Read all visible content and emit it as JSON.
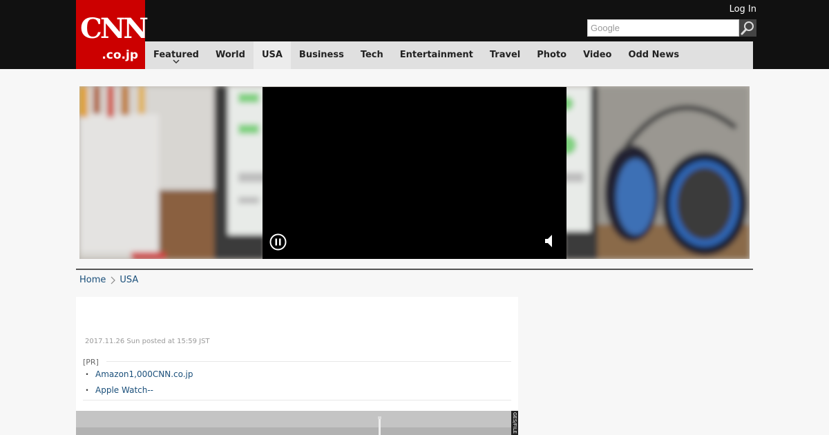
{
  "header": {
    "logo_main": "CNN",
    "logo_sub": ".co.jp",
    "login_label": "Log In",
    "search_placeholder": "Google"
  },
  "nav": {
    "items": [
      {
        "label": "Featured"
      },
      {
        "label": "World"
      },
      {
        "label": "USA"
      },
      {
        "label": "Business"
      },
      {
        "label": "Tech"
      },
      {
        "label": "Entertainment"
      },
      {
        "label": "Travel"
      },
      {
        "label": "Photo"
      },
      {
        "label": "Video"
      },
      {
        "label": "Odd News"
      }
    ],
    "active": "USA"
  },
  "breadcrumb": {
    "home": "Home",
    "current": "USA"
  },
  "article": {
    "dateline": "2017.11.26 Sun posted at 15:59 JST",
    "pr_label": "[PR]",
    "pr_links": [
      {
        "text": "Amazon1,000CNN.co.jp"
      },
      {
        "text": "Apple Watch--"
      }
    ],
    "photo_credit": "GES/FILE"
  },
  "colors": {
    "brand": "#cc0000",
    "link": "#1a4f7a",
    "topbar": "#111111"
  }
}
